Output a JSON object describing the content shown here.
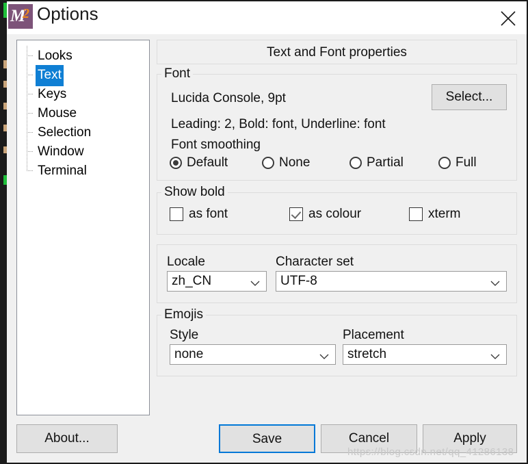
{
  "window": {
    "title": "Options",
    "icon": "mintty-icon",
    "icon_text_m": "M",
    "icon_text_2": "2",
    "close_icon": "close-icon"
  },
  "sidebar": {
    "items": [
      {
        "label": "Looks",
        "selected": false
      },
      {
        "label": "Text",
        "selected": true
      },
      {
        "label": "Keys",
        "selected": false
      },
      {
        "label": "Mouse",
        "selected": false
      },
      {
        "label": "Selection",
        "selected": false
      },
      {
        "label": "Window",
        "selected": false
      },
      {
        "label": "Terminal",
        "selected": false
      }
    ]
  },
  "panel": {
    "header": "Text and Font properties",
    "font_group": {
      "label": "Font",
      "font_name": "Lucida Console, 9pt",
      "select_button": "Select...",
      "details": "Leading: 2, Bold: font, Underline: font",
      "smoothing_label": "Font smoothing",
      "smoothing_options": [
        {
          "label": "Default",
          "checked": true
        },
        {
          "label": "None",
          "checked": false
        },
        {
          "label": "Partial",
          "checked": false
        },
        {
          "label": "Full",
          "checked": false
        }
      ]
    },
    "bold_group": {
      "label": "Show bold",
      "options": [
        {
          "label": "as font",
          "checked": false
        },
        {
          "label": "as colour",
          "checked": true
        },
        {
          "label": "xterm",
          "checked": false
        }
      ]
    },
    "locale_group": {
      "locale_label": "Locale",
      "locale_value": "zh_CN",
      "charset_label": "Character set",
      "charset_value": "UTF-8"
    },
    "emoji_group": {
      "label": "Emojis",
      "style_label": "Style",
      "style_value": "none",
      "placement_label": "Placement",
      "placement_value": "stretch"
    }
  },
  "footer": {
    "about": "About...",
    "save": "Save",
    "cancel": "Cancel",
    "apply": "Apply"
  },
  "watermark": "https://blog.csdn.net/qq_41286138",
  "colors": {
    "accent": "#0078d7",
    "selection": "#0f7fd4",
    "dialog_bg": "#f0f0f0",
    "button_bg": "#e1e1e1",
    "logo_purple": "#7d5379",
    "logo_orange": "#f08a1c"
  }
}
